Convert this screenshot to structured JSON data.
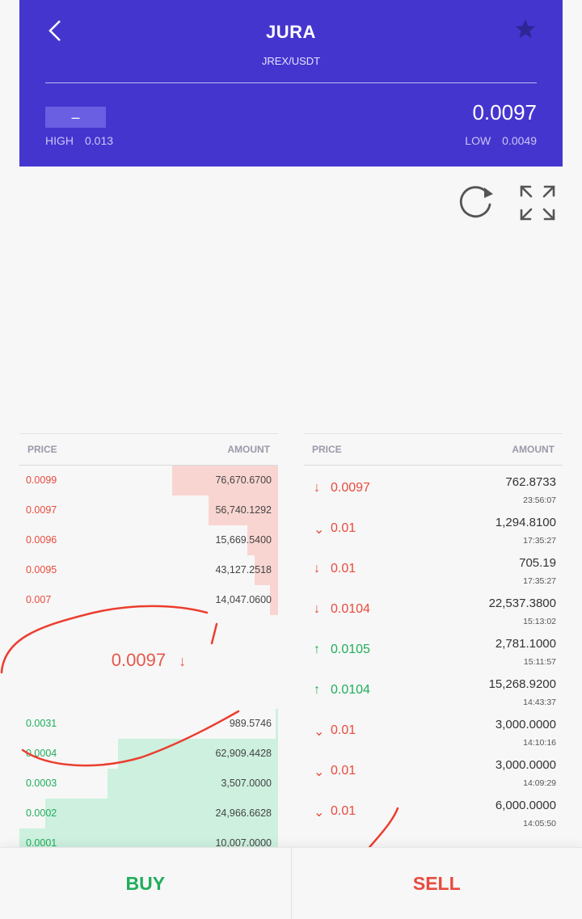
{
  "header": {
    "title": "JURA",
    "pair": "JREX/USDT",
    "change": "–",
    "high_label": "HIGH",
    "high_value": "0.013",
    "low_label": "LOW",
    "low_value": "0.0049",
    "last_price": "0.0097",
    "colors": {
      "background": "#4535cf",
      "star": "#2d2696"
    },
    "icons": {
      "back": "chevron-left-icon",
      "favorite": "star-icon"
    }
  },
  "chart_controls": {
    "icons": [
      "refresh-icon",
      "expand-icon"
    ]
  },
  "orderbook": {
    "price_header": "PRICE",
    "amount_header": "AMOUNT",
    "asks": [
      {
        "price": "0.0099",
        "amount": "76,670.6700",
        "depth": 0.41
      },
      {
        "price": "0.0097",
        "amount": "56,740.1292",
        "depth": 0.27
      },
      {
        "price": "0.0096",
        "amount": "15,669.5400",
        "depth": 0.12
      },
      {
        "price": "0.0095",
        "amount": "43,127.2518",
        "depth": 0.09
      },
      {
        "price": "0.007",
        "amount": "14,047.0600",
        "depth": 0.03
      }
    ],
    "mid_price": "0.0097",
    "mid_arrow": "↓",
    "bids": [
      {
        "price": "0.0031",
        "amount": "989.5746",
        "depth": 0.01
      },
      {
        "price": "0.0004",
        "amount": "62,909.4428",
        "depth": 0.62
      },
      {
        "price": "0.0003",
        "amount": "3,507.0000",
        "depth": 0.66
      },
      {
        "price": "0.0002",
        "amount": "24,966.6628",
        "depth": 0.9
      },
      {
        "price": "0.0001",
        "amount": "10,007.0000",
        "depth": 1.0
      }
    ],
    "colors": {
      "ask_bar": "#f9d5d1",
      "bid_bar": "#cdf0df",
      "ask_text": "#e84b3d",
      "bid_text": "#1fae5a"
    }
  },
  "trades": {
    "price_header": "PRICE",
    "amount_header": "AMOUNT",
    "rows": [
      {
        "dir": "down",
        "arrow": "↓",
        "price": "0.0097",
        "amount": "762.8733",
        "time": "23:56:07"
      },
      {
        "dir": "down",
        "arrow": "⌄",
        "price": "0.01",
        "amount": "1,294.8100",
        "time": "17:35:27"
      },
      {
        "dir": "down",
        "arrow": "↓",
        "price": "0.01",
        "amount": "705.19",
        "time": "17:35:27"
      },
      {
        "dir": "down",
        "arrow": "↓",
        "price": "0.0104",
        "amount": "22,537.3800",
        "time": "15:13:02"
      },
      {
        "dir": "up",
        "arrow": "↑",
        "price": "0.0105",
        "amount": "2,781.1000",
        "time": "15:11:57"
      },
      {
        "dir": "up",
        "arrow": "↑",
        "price": "0.0104",
        "amount": "15,268.9200",
        "time": "14:43:37"
      },
      {
        "dir": "down",
        "arrow": "⌄",
        "price": "0.01",
        "amount": "3,000.0000",
        "time": "14:10:16"
      },
      {
        "dir": "down",
        "arrow": "⌄",
        "price": "0.01",
        "amount": "3,000.0000",
        "time": "14:09:29"
      },
      {
        "dir": "down",
        "arrow": "⌄",
        "price": "0.01",
        "amount": "6,000.0000",
        "time": "14:05:50"
      }
    ]
  },
  "actions": {
    "buy_label": "BUY",
    "sell_label": "SELL"
  }
}
